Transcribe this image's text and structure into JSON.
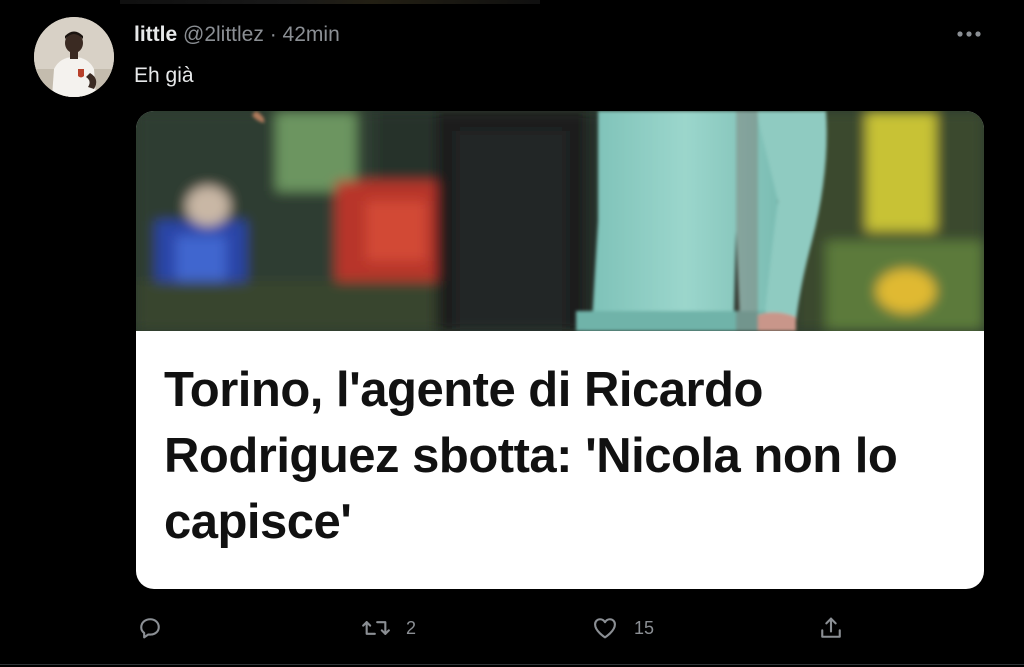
{
  "tweet": {
    "display_name": "little",
    "handle": "@2littlez",
    "separator": "·",
    "timestamp": "42min",
    "text": "Eh già",
    "more_icon": "more-horizontal-icon"
  },
  "card": {
    "title": "Torino, l'agente di Ricardo Rodriguez sbotta: 'Nicola non lo capisce'"
  },
  "actions": {
    "reply": {
      "icon": "reply-icon"
    },
    "retweet": {
      "icon": "retweet-icon",
      "count": "2"
    },
    "like": {
      "icon": "heart-icon",
      "count": "15"
    },
    "share": {
      "icon": "share-icon"
    }
  },
  "colors": {
    "background": "#000000",
    "primary_text": "#e7e9ea",
    "secondary_text": "#8b8f94",
    "card_background": "#ffffff",
    "card_text": "#111111"
  }
}
